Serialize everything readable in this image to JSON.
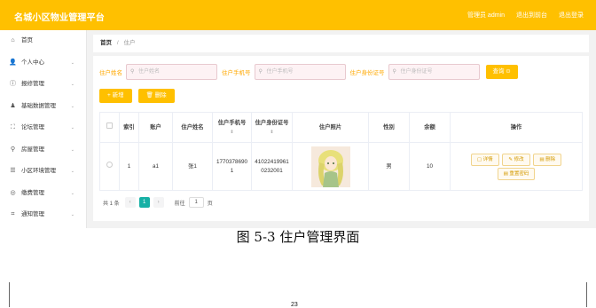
{
  "app": {
    "title": "名城小区物业管理平台",
    "topnav": [
      "管理员 admin",
      "退出到前台",
      "退出登录"
    ]
  },
  "sidebar": {
    "items": [
      {
        "label": "首页",
        "icon": "home-icon",
        "glyph": "⌂",
        "arrow": ""
      },
      {
        "label": "个人中心",
        "icon": "user-icon",
        "glyph": "👤",
        "arrow": "⌄"
      },
      {
        "label": "报修管理",
        "icon": "info-icon",
        "glyph": "ⓘ",
        "arrow": "⌄"
      },
      {
        "label": "基础数据管理",
        "icon": "person-icon",
        "glyph": "♟",
        "arrow": "⌄"
      },
      {
        "label": "论坛管理",
        "icon": "expand-icon",
        "glyph": "⛶",
        "arrow": "⌄"
      },
      {
        "label": "房屋管理",
        "icon": "pin-icon",
        "glyph": "⚲",
        "arrow": "⌄"
      },
      {
        "label": "小区环境管理",
        "icon": "menu-icon",
        "glyph": "☰",
        "arrow": "⌄"
      },
      {
        "label": "缴费管理",
        "icon": "contacts-icon",
        "glyph": "◎",
        "arrow": "⌄"
      },
      {
        "label": "通知管理",
        "icon": "crop-icon",
        "glyph": "⌗",
        "arrow": "⌄"
      }
    ]
  },
  "breadcrumb": {
    "home": "首页",
    "sep": "/",
    "current": "住户"
  },
  "search": {
    "fields": [
      {
        "label": "住户姓名",
        "placeholder": "住户姓名"
      },
      {
        "label": "住户手机号",
        "placeholder": "住户手机号"
      },
      {
        "label": "住户身份证号",
        "placeholder": "住户身份证号"
      }
    ],
    "button": "查询 ⊙"
  },
  "actions": {
    "add": "+ 新增",
    "delete": "🗑 删除"
  },
  "table": {
    "headers": [
      "索引",
      "账户",
      "住户姓名",
      "住户手机号",
      "住户身份证号",
      "住户照片",
      "性别",
      "余额",
      "操作"
    ],
    "sortable": [
      "",
      "",
      "",
      "⇕",
      "⇕",
      "",
      "",
      "",
      ""
    ],
    "rows": [
      {
        "index": "1",
        "account": "a1",
        "name": "张1",
        "phone": "17703786901",
        "id_card": "410224199610232001",
        "gender": "男",
        "balance": "10",
        "ops": [
          "详情",
          "修改",
          "删除",
          "重置密码"
        ]
      }
    ]
  },
  "pager": {
    "total": "共 1 条",
    "prev": "‹",
    "page": "1",
    "next": "›",
    "goto_label": "前往",
    "goto_value": "1",
    "goto_suffix": "页"
  },
  "caption": "图 5-3 住户管理界面",
  "page_number": "23",
  "colors": {
    "accent": "#ffc000",
    "pager_active": "#16b0a5",
    "search_label": "#ffa800"
  }
}
